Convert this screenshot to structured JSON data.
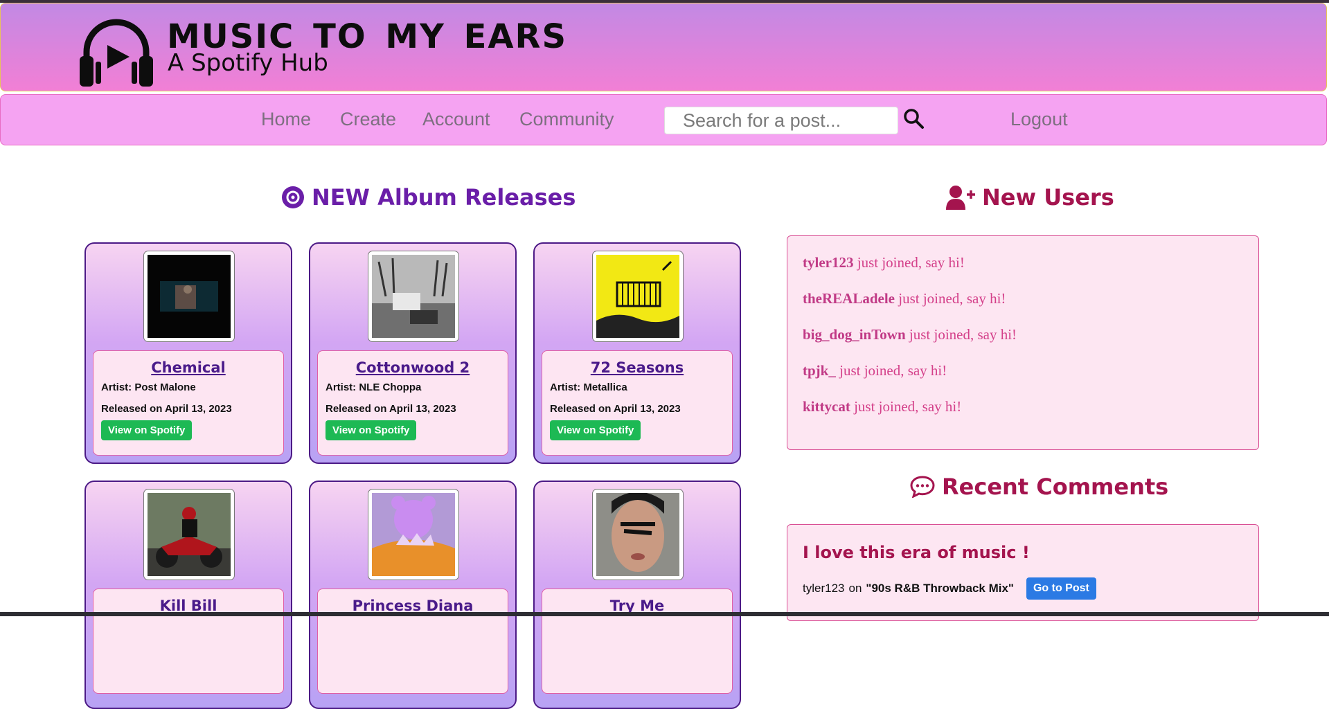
{
  "header": {
    "title": "MUSIC TO MY EARS",
    "subtitle": "A Spotify Hub",
    "logo_icon": "headphones-play-icon"
  },
  "nav": {
    "items": [
      "Home",
      "Create",
      "Account",
      "Community"
    ],
    "search_placeholder": "Search for a post...",
    "search_icon": "search-icon",
    "logout": "Logout"
  },
  "albums": {
    "title": "NEW Album Releases",
    "title_icon": "vinyl-disc-icon",
    "button_label": "View on Spotify",
    "items": [
      {
        "name": "Chemical",
        "artist": "Artist: Post Malone",
        "released": "Released on April 13, 2023"
      },
      {
        "name": "Cottonwood 2",
        "artist": "Artist: NLE Choppa",
        "released": "Released on April 13, 2023"
      },
      {
        "name": "72 Seasons",
        "artist": "Artist: Metallica",
        "released": "Released on April 13, 2023"
      },
      {
        "name": "Kill Bill"
      },
      {
        "name": "Princess Diana"
      },
      {
        "name": "Try Me"
      }
    ]
  },
  "users": {
    "title": "New Users",
    "title_icon": "user-plus-icon",
    "suffix": "just joined, say hi!",
    "items": [
      "tyler123",
      "theREALadele",
      "big_dog_inTown",
      "tpjk_",
      "kittycat"
    ]
  },
  "comments": {
    "title": "Recent Comments",
    "title_icon": "comment-dots-icon",
    "items": [
      {
        "text": "I love this era of music !",
        "user": "tyler123",
        "on": "on",
        "post": "\"90s R&B Throwback Mix\"",
        "button": "Go to Post"
      }
    ]
  },
  "colors": {
    "header_gradient_top": "#c289e4",
    "header_gradient_bottom": "#f27fd5",
    "nav_bg": "#f5a3f2",
    "album_title": "#6a1ea8",
    "section_title": "#a4144e",
    "spotify_green": "#1db954",
    "goto_blue": "#2b7ae4"
  }
}
